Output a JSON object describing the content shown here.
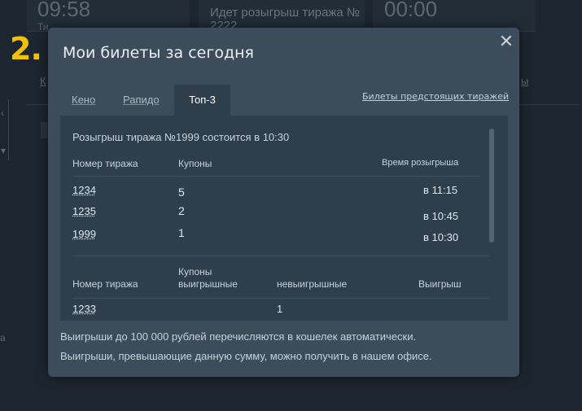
{
  "background": {
    "left_clock": "09:58",
    "left_clock_caption": "Ти",
    "draw_status_line1": "Идет розыгрыш тиража №",
    "draw_status_line2": "2222",
    "right_clock": "00:00",
    "step_label": "2.",
    "left_link": "К",
    "right_link": "ы",
    "left_text": "а"
  },
  "modal": {
    "title": "Мои билеты за сегодня",
    "close_icon": "close-icon",
    "tabs": [
      {
        "label": "Кено",
        "active": false
      },
      {
        "label": "Рапидо",
        "active": false
      },
      {
        "label": "Топ-3",
        "active": true
      }
    ],
    "future_link": "Билеты предстоящих тиражей",
    "upcoming_notice": "Розыгрыш тиража №1999 состоится в 10:30",
    "tickets_table": {
      "headers": [
        "Номер тиража",
        "Купоны",
        "Время розыгрыша"
      ],
      "rows": [
        {
          "draw": "1234",
          "coupons": "5",
          "time": "в 11:15",
          "highlight": false
        },
        {
          "draw": "1235",
          "coupons": "2",
          "time": "в 10:45",
          "highlight": false
        },
        {
          "draw": "1999",
          "coupons": "1",
          "time": "в 10:30",
          "highlight": true
        }
      ]
    },
    "results_table": {
      "header_draw": "Номер тиража",
      "header_coupons": "Купоны",
      "header_winning": "выигрышные",
      "header_losing": "невыигрышные",
      "header_win": "Выигрыш",
      "partial_row": {
        "draw": "1233",
        "losing": "1"
      }
    },
    "footer_line1": "Выигрыши до 100 000 рублей перечисляются в кошелек автоматически.",
    "footer_line2": "Выигрыши, превышающие данную сумму, можно получить в нашем офисе."
  },
  "colors": {
    "accent_green": "#8ed43c",
    "step_yellow": "#f2c200",
    "modal_bg": "#3c4c5a",
    "panel_bg": "#2f3e4b"
  }
}
